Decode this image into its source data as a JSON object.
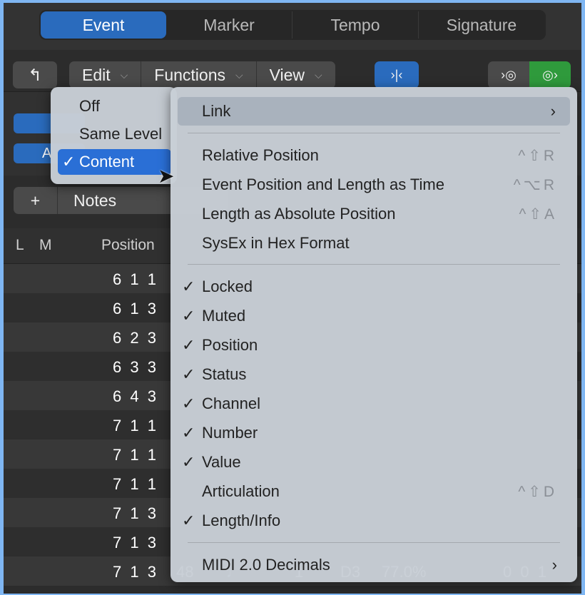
{
  "tabs": [
    {
      "label": "Event",
      "active": true
    },
    {
      "label": "Marker"
    },
    {
      "label": "Tempo"
    },
    {
      "label": "Signature"
    }
  ],
  "toolbar": {
    "up_icon": "arrow-up-hook",
    "edit": "Edit",
    "functions": "Functions",
    "view": "View",
    "catch_icon": "catch-playhead",
    "midi_in_icon": "midi-in",
    "midi_out_icon": "midi-out"
  },
  "mid": {
    "btn2_label": "A"
  },
  "notes": {
    "add": "+",
    "label": "Notes"
  },
  "header": {
    "l": "L",
    "m": "M",
    "position": "Position"
  },
  "rows": [
    "6 1 1",
    "6 1 3",
    "6 2 3",
    "6 3 3",
    "6 4 3",
    "7 1 1",
    "7 1 1",
    "7 1 1",
    "7 1 3",
    "7 1 3",
    "7 1 3"
  ],
  "last_row": {
    "tick": "48",
    "channel": "1",
    "num": "D3",
    "value": "77.0%",
    "length": "0 0 1"
  },
  "submenu": {
    "items": [
      {
        "label": "Off"
      },
      {
        "label": "Same Level"
      },
      {
        "label": "Content",
        "checked": true
      }
    ],
    "check": "✓"
  },
  "menu": {
    "link": "Link",
    "group1": [
      {
        "label": "Relative Position",
        "shortcut": "^⇧R"
      },
      {
        "label": "Event Position and Length as Time",
        "shortcut": "^⌥R"
      },
      {
        "label": "Length as Absolute Position",
        "shortcut": "^⇧A"
      },
      {
        "label": "SysEx in Hex Format",
        "shortcut": ""
      }
    ],
    "group2": [
      {
        "label": "Locked",
        "checked": true
      },
      {
        "label": "Muted",
        "checked": true
      },
      {
        "label": "Position",
        "checked": true
      },
      {
        "label": "Status",
        "checked": true
      },
      {
        "label": "Channel",
        "checked": true
      },
      {
        "label": "Number",
        "checked": true
      },
      {
        "label": "Value",
        "checked": true
      },
      {
        "label": "Articulation",
        "checked": false,
        "shortcut": "^⇧D"
      },
      {
        "label": "Length/Info",
        "checked": true
      }
    ],
    "midi2": "MIDI 2.0 Decimals"
  },
  "colors": {
    "accent": "#2a6bbd",
    "green": "#2f9a3c"
  }
}
